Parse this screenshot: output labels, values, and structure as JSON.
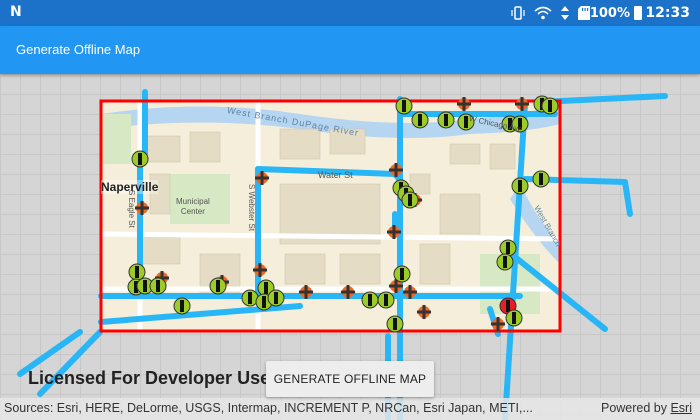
{
  "status_bar": {
    "logo_icon": "N",
    "battery": "100%",
    "time": "12:33",
    "icons": [
      "vibrate-icon",
      "wifi-icon",
      "data-icon",
      "sd-card-icon",
      "battery-icon"
    ]
  },
  "app_bar": {
    "title": "Generate Offline Map"
  },
  "map": {
    "labels": {
      "naperville": "Naperville",
      "municipal_center": "Municipal\nCenter",
      "dupage_river": "West Branch DuPage River",
      "water_st": "Water St",
      "webster_st": "S Webster St",
      "eagle_st": "S Eagle St",
      "chicago_ave": "W Chicago Ave",
      "west_branch": "West Branch"
    },
    "extent_color": "#ff0000",
    "line_color": "#29b6f6"
  },
  "license_text": "Licensed For Developer Use",
  "generate_button": "GENERATE OFFLINE MAP",
  "attribution": {
    "sources": "Sources: Esri, HERE, DeLorme, USGS, Intermap, INCREMENT P, NRCan, Esri Japan, METI,...",
    "powered_prefix": "Powered by ",
    "powered_brand": "Esri"
  }
}
